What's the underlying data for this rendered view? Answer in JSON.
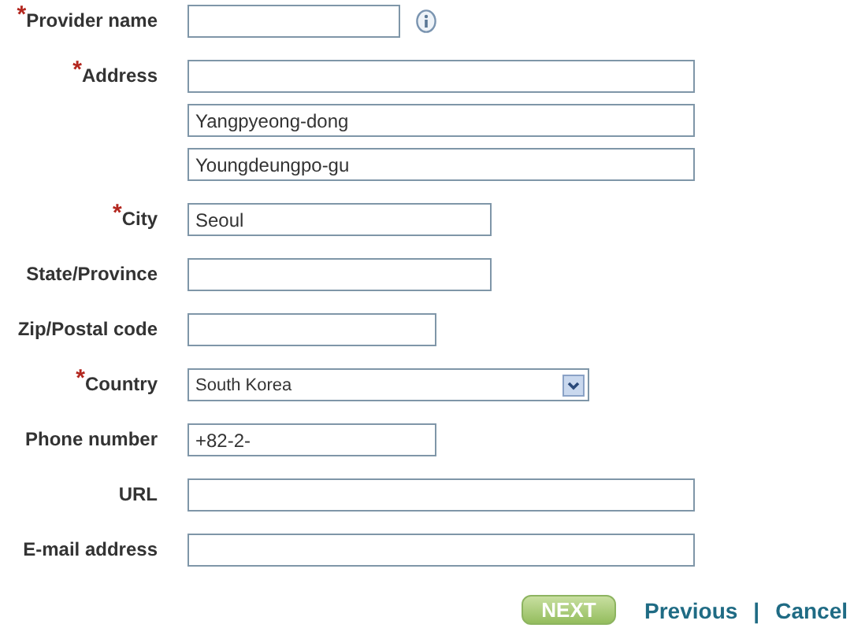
{
  "fields": [
    {
      "label": "Provider name",
      "marker": "*",
      "info": true,
      "inputs": [
        {
          "kind": "text"
        }
      ]
    },
    {
      "label": "Address",
      "marker": "*",
      "inputs": [
        {
          "kind": "text"
        },
        {
          "kind": "text",
          "value": "Yangpyeong-dong"
        },
        {
          "kind": "text",
          "value": "Youngdeungpo-gu"
        }
      ]
    },
    {
      "label": "City",
      "marker": "*",
      "inputs": [
        {
          "kind": "text",
          "value": "Seoul"
        }
      ]
    },
    {
      "label": "State/Province",
      "inputs": [
        {
          "kind": "text"
        }
      ]
    },
    {
      "label": "Zip/Postal code",
      "inputs": [
        {
          "kind": "text"
        }
      ]
    },
    {
      "label": "Country",
      "marker": "*",
      "inputs": [
        {
          "kind": "select",
          "value": "South Korea"
        }
      ]
    },
    {
      "label": "Phone number",
      "inputs": [
        {
          "kind": "text",
          "value": "+82-2-"
        }
      ]
    },
    {
      "label": "URL",
      "inputs": [
        {
          "kind": "text"
        }
      ]
    },
    {
      "label": "E-mail address",
      "inputs": [
        {
          "kind": "text"
        }
      ]
    }
  ],
  "actions": {
    "next": "NEXT",
    "previous": "Previous",
    "separator": "|",
    "cancel": "Cancel"
  }
}
